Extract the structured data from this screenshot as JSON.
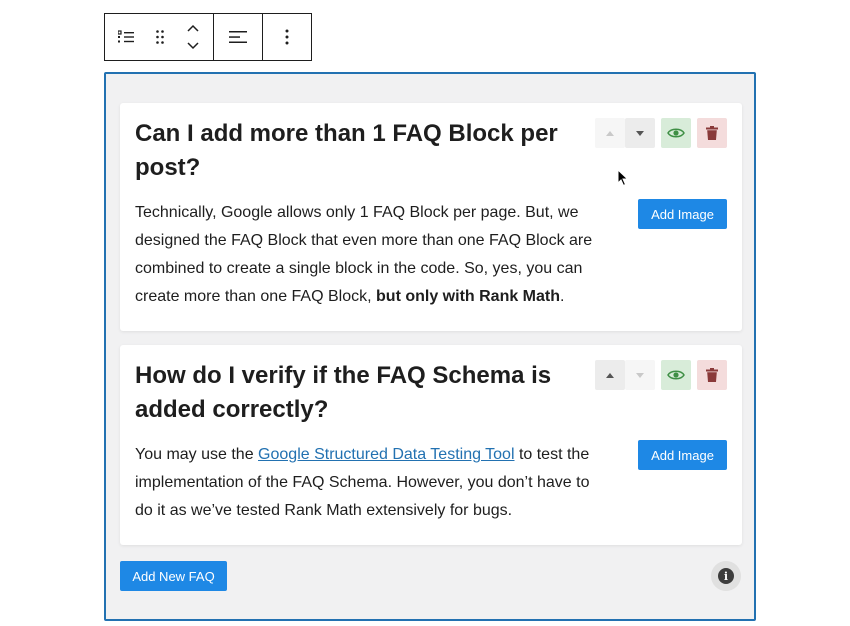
{
  "toolbar": {
    "icons": [
      "list-view-icon",
      "drag-handle-icon",
      "chevron-up-icon",
      "chevron-down-icon",
      "align-icon",
      "more-options-icon"
    ]
  },
  "faqs": [
    {
      "question": "Can I add more than 1 FAQ Block per post?",
      "answer_text": "Technically, Google allows only 1 FAQ Block per page. But, we designed the FAQ Block that even more than one FAQ Block are combined to create a single block in the code. So, yes, you can create more than one FAQ Block, ",
      "answer_bold": "but only with Rank Math",
      "answer_end": ".",
      "add_image": "Add Image"
    },
    {
      "question": "How do I verify if the FAQ Schema is added correctly?",
      "answer_pre": "You may use the ",
      "answer_link": "Google Structured Data Testing Tool",
      "answer_post": " to test the implementation of the FAQ Schema. However, you don’t have to do it as we’ve tested Rank Math extensively for bugs.",
      "add_image": "Add Image"
    }
  ],
  "add_new_faq": "Add New FAQ",
  "colors": {
    "accent": "#2271b1",
    "button": "#1e88e5",
    "eye_bg": "#d8ecd9",
    "trash_bg": "#f4dcdc"
  }
}
